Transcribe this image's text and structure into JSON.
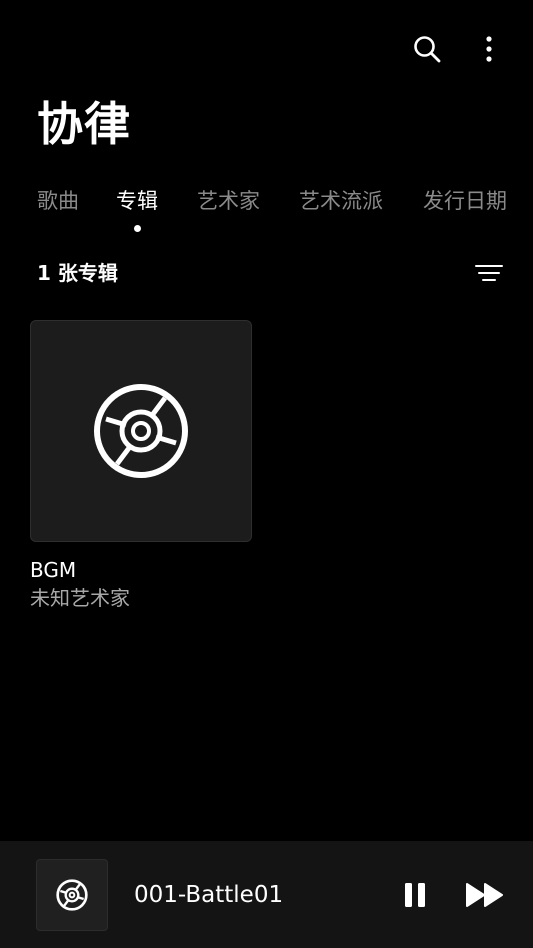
{
  "header": {
    "title": "协律",
    "search_icon": "search-icon",
    "more_icon": "more-vertical-icon"
  },
  "tabs": [
    {
      "label": "歌曲",
      "active": false
    },
    {
      "label": "专辑",
      "active": true
    },
    {
      "label": "艺术家",
      "active": false
    },
    {
      "label": "艺术流派",
      "active": false
    },
    {
      "label": "发行日期",
      "active": false
    }
  ],
  "albums_section": {
    "count_label": "1 张专辑",
    "sort_icon": "sort-icon"
  },
  "albums": [
    {
      "title": "BGM",
      "artist": "未知艺术家",
      "cover_icon": "disc-icon"
    }
  ],
  "now_playing": {
    "title": "001-Battle01",
    "thumb_icon": "disc-icon",
    "pause_icon": "pause-icon",
    "next_icon": "skip-forward-icon"
  },
  "colors": {
    "background": "#000000",
    "card": "#1c1c1c",
    "player_bar": "#141414",
    "inactive_text": "#8a8a8a",
    "secondary_text": "#a8a8a8"
  }
}
